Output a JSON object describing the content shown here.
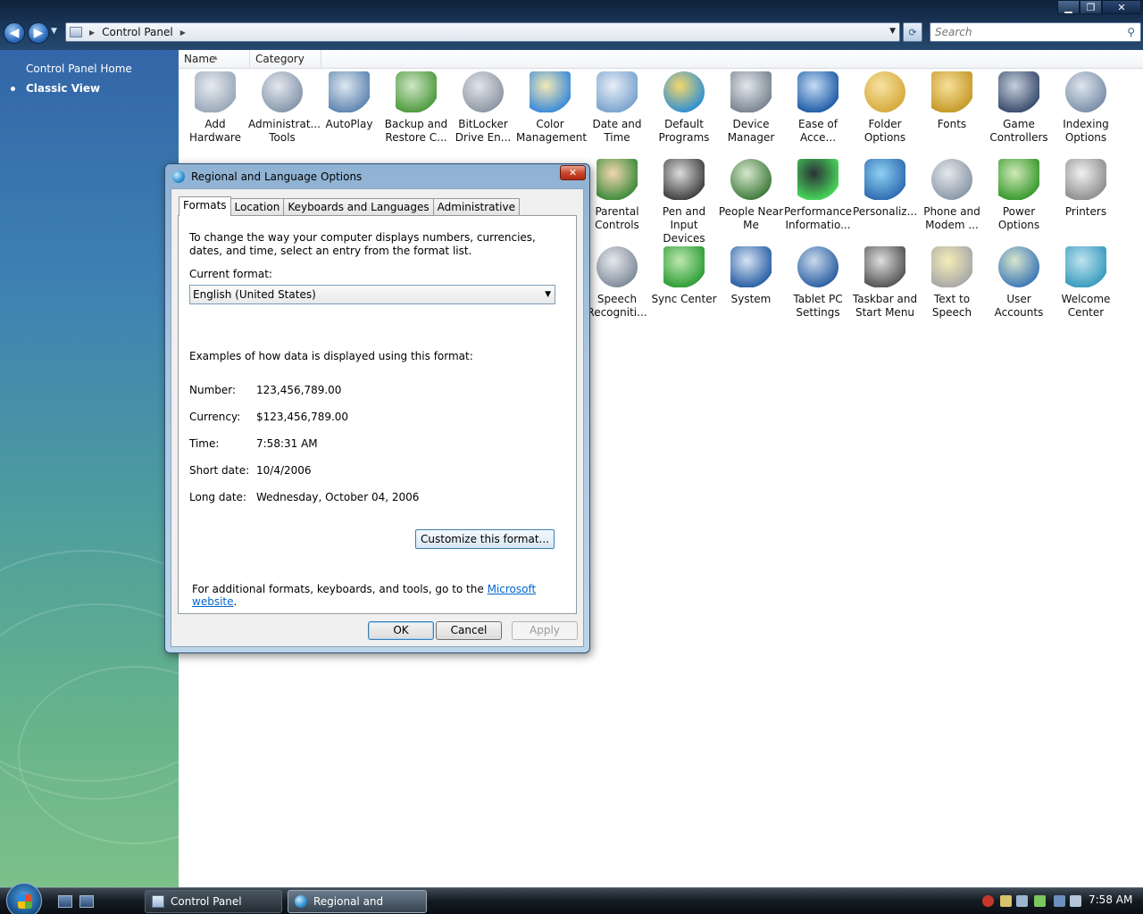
{
  "window": {
    "address": {
      "crumb": "Control Panel"
    },
    "search": {
      "placeholder": "Search"
    }
  },
  "left_pane": {
    "home_link": "Control Panel Home",
    "classic_view": "Classic View"
  },
  "columns": {
    "name": "Name",
    "category": "Category"
  },
  "items": [
    {
      "label_1": "Add",
      "label_2": "Hardware",
      "icon": "add-hardware-icon"
    },
    {
      "label_1": "Administrat...",
      "label_2": "Tools",
      "icon": "administrative-tools-icon"
    },
    {
      "label_1": "AutoPlay",
      "label_2": "",
      "icon": "autoplay-icon"
    },
    {
      "label_1": "Backup and",
      "label_2": "Restore C...",
      "icon": "backup-restore-icon"
    },
    {
      "label_1": "BitLocker",
      "label_2": "Drive En...",
      "icon": "bitlocker-icon"
    },
    {
      "label_1": "Color",
      "label_2": "Management",
      "icon": "color-management-icon"
    },
    {
      "label_1": "Date and",
      "label_2": "Time",
      "icon": "date-time-icon"
    },
    {
      "label_1": "Default",
      "label_2": "Programs",
      "icon": "default-programs-icon"
    },
    {
      "label_1": "Device",
      "label_2": "Manager",
      "icon": "device-manager-icon"
    },
    {
      "label_1": "Ease of",
      "label_2": "Acce...",
      "icon": "ease-of-access-icon"
    },
    {
      "label_1": "Folder",
      "label_2": "Options",
      "icon": "folder-options-icon"
    },
    {
      "label_1": "Fonts",
      "label_2": "",
      "icon": "fonts-icon"
    },
    {
      "label_1": "Game",
      "label_2": "Controllers",
      "icon": "game-controllers-icon"
    },
    {
      "label_1": "Indexing",
      "label_2": "Options",
      "icon": "indexing-options-icon"
    },
    {
      "label_1": "Parental",
      "label_2": "Controls",
      "icon": "parental-controls-icon"
    },
    {
      "label_1": "Pen and",
      "label_2": "Input Devices",
      "icon": "pen-input-icon"
    },
    {
      "label_1": "People Near",
      "label_2": "Me",
      "icon": "people-near-me-icon"
    },
    {
      "label_1": "Performance",
      "label_2": "Informatio...",
      "icon": "performance-icon"
    },
    {
      "label_1": "Personaliz...",
      "label_2": "",
      "icon": "personalization-icon"
    },
    {
      "label_1": "Phone and",
      "label_2": "Modem ...",
      "icon": "phone-modem-icon"
    },
    {
      "label_1": "Power",
      "label_2": "Options",
      "icon": "power-options-icon"
    },
    {
      "label_1": "Printers",
      "label_2": "",
      "icon": "printers-icon"
    },
    {
      "label_1": "Speech",
      "label_2": "Recogniti...",
      "icon": "speech-recognition-icon"
    },
    {
      "label_1": "Sync Center",
      "label_2": "",
      "icon": "sync-center-icon"
    },
    {
      "label_1": "System",
      "label_2": "",
      "icon": "system-icon"
    },
    {
      "label_1": "Tablet PC",
      "label_2": "Settings",
      "icon": "tablet-pc-icon"
    },
    {
      "label_1": "Taskbar and",
      "label_2": "Start Menu",
      "icon": "taskbar-start-icon"
    },
    {
      "label_1": "Text to",
      "label_2": "Speech",
      "icon": "text-to-speech-icon"
    },
    {
      "label_1": "User",
      "label_2": "Accounts",
      "icon": "user-accounts-icon"
    },
    {
      "label_1": "Welcome",
      "label_2": "Center",
      "icon": "welcome-center-icon"
    }
  ],
  "dialog": {
    "title": "Regional and Language Options",
    "tabs": [
      "Formats",
      "Location",
      "Keyboards and Languages",
      "Administrative"
    ],
    "active_tab": "Formats",
    "intro": "To change the way your computer displays numbers, currencies, dates, and time, select an entry from the format list.",
    "current_format_label": "Current format:",
    "current_format_value": "English (United States)",
    "examples_label": "Examples of how data is displayed using this format:",
    "examples": [
      {
        "key": "Number:",
        "value": "123,456,789.00"
      },
      {
        "key": "Currency:",
        "value": "$123,456,789.00"
      },
      {
        "key": "Time:",
        "value": "7:58:31 AM"
      },
      {
        "key": "Short date:",
        "value": "10/4/2006"
      },
      {
        "key": "Long date:",
        "value": "Wednesday, October 04, 2006"
      }
    ],
    "customize_label": "Customize this format...",
    "additional_text": "For additional formats, keyboards, and tools, go to the",
    "additional_link": "Microsoft website",
    "additional_end": ".",
    "ok": "OK",
    "cancel": "Cancel",
    "apply": "Apply"
  },
  "taskbar": {
    "tasks": [
      "Control Panel",
      "Regional and Langu..."
    ],
    "clock": "7:58 AM"
  }
}
